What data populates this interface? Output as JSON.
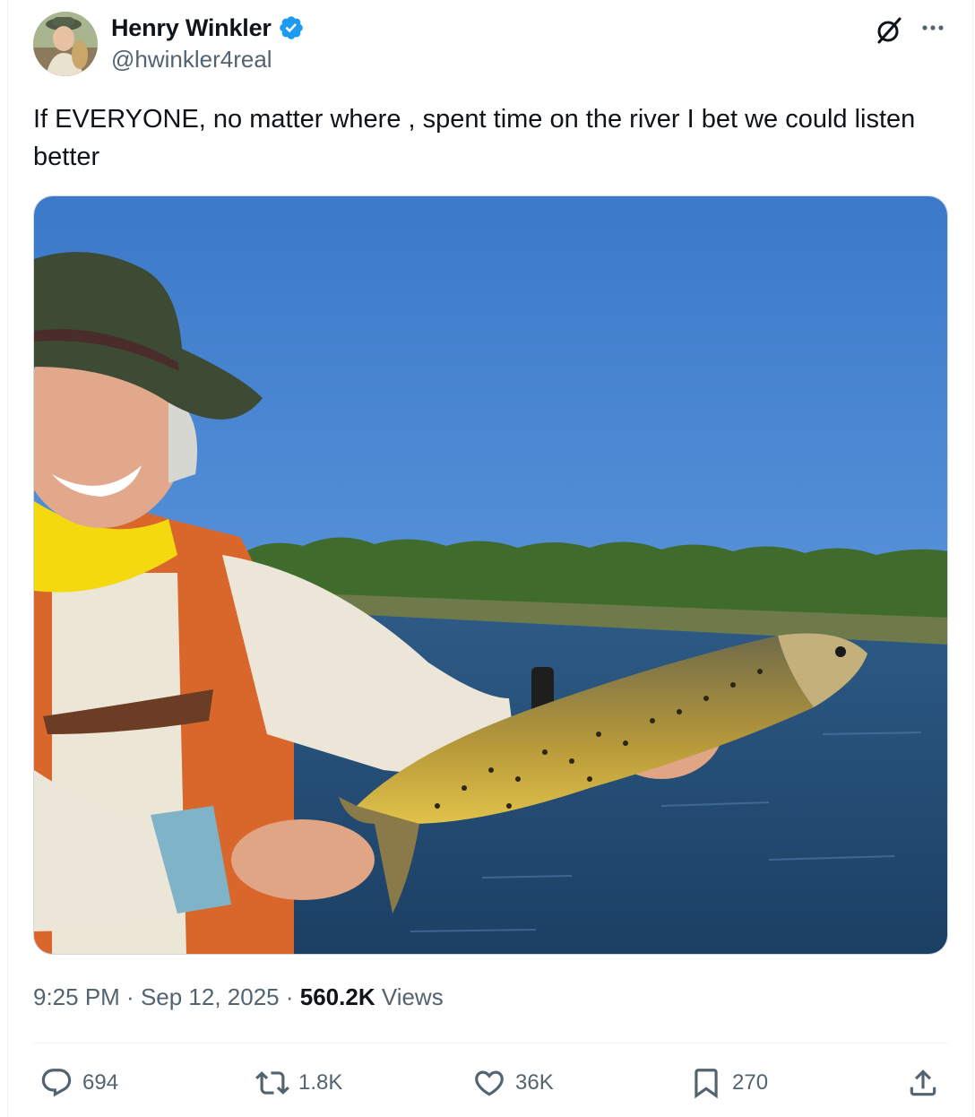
{
  "author": {
    "display_name": "Henry Winkler",
    "handle": "@hwinkler4real",
    "verified": true,
    "avatar_icon": "profile-photo-avatar"
  },
  "tweet": {
    "text": "If EVERYONE, no matter where , spent time on the river I bet we could listen better",
    "media_description_icon": "photo-man-holding-trout-on-river"
  },
  "meta": {
    "time": "9:25 PM",
    "sep1": " · ",
    "date": "Sep 12, 2025",
    "sep2": " · ",
    "views_count": "560.2K",
    "views_label": " Views"
  },
  "actions": {
    "replies": "694",
    "reposts": "1.8K",
    "likes": "36K",
    "bookmarks": "270"
  },
  "colors": {
    "text": "#0f1419",
    "secondary": "#536471",
    "verified_badge": "#1d9bf0",
    "divider": "#eff3f4"
  }
}
